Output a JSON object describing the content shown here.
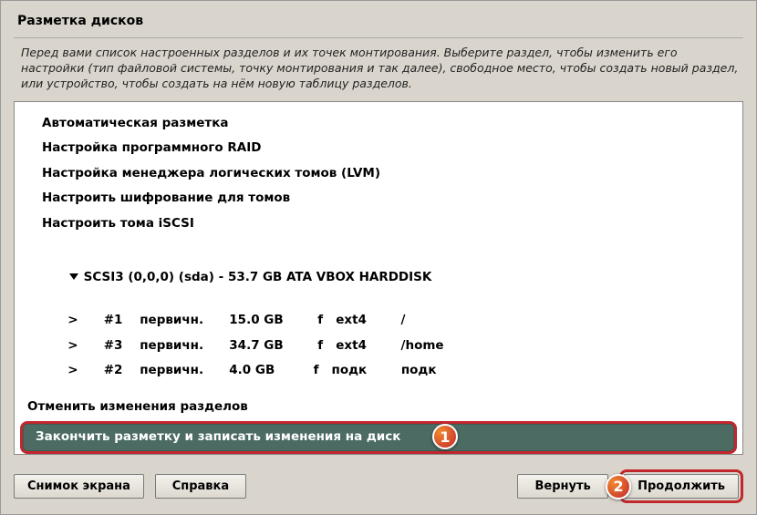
{
  "title": "Разметка дисков",
  "description": "Перед вами список настроенных разделов и их точек монтирования. Выберите раздел, чтобы изменить его настройки (тип файловой системы, точку монтирования и так далее), свободное место, чтобы создать новый раздел, или устройство, чтобы создать на нём новую таблицу разделов.",
  "menu": {
    "auto": "Автоматическая разметка",
    "raid": "Настройка программного RAID",
    "lvm": "Настройка менеджера логических томов (LVM)",
    "crypt": "Настроить шифрование для томов",
    "iscsi": "Настроить тома iSCSI"
  },
  "disk": {
    "header": "SCSI3 (0,0,0) (sda) - 53.7 GB ATA VBOX HARDDISK",
    "partitions": [
      {
        "num": "#1",
        "type": "первичн.",
        "size": "15.0 GB",
        "flag": "f",
        "fs": "ext4",
        "mount": "/"
      },
      {
        "num": "#3",
        "type": "первичн.",
        "size": "34.7 GB",
        "flag": "f",
        "fs": "ext4",
        "mount": "/home"
      },
      {
        "num": "#2",
        "type": "первичн.",
        "size": "4.0 GB",
        "flag": "f",
        "fs": "подк",
        "mount": "подк"
      }
    ]
  },
  "undo": "Отменить изменения разделов",
  "finish": "Закончить разметку и записать изменения на диск",
  "buttons": {
    "screenshot": "Снимок экрана",
    "help": "Справка",
    "back": "Вернуть",
    "continue": "Продолжить"
  },
  "badges": {
    "one": "1",
    "two": "2"
  }
}
